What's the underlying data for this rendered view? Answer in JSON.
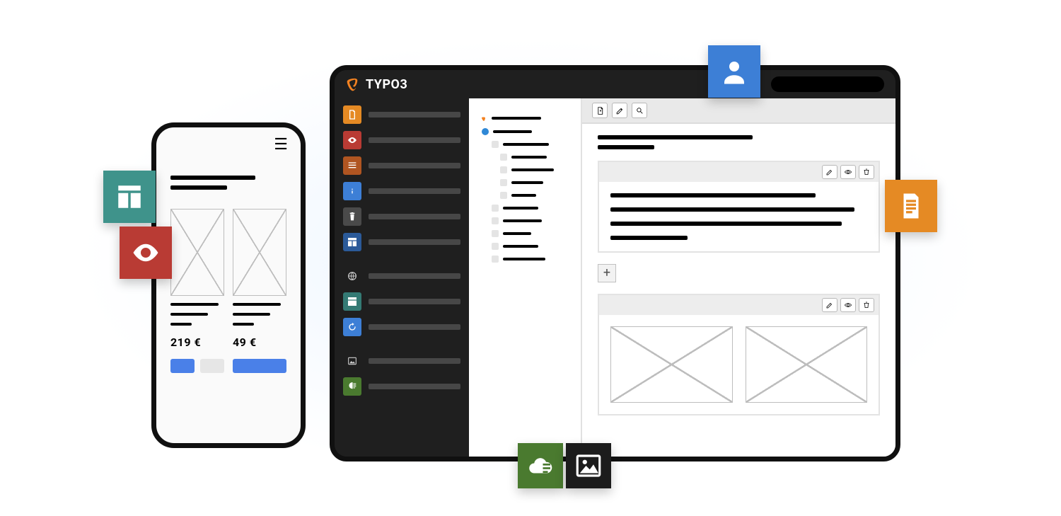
{
  "app": {
    "name": "TYPO3"
  },
  "phone": {
    "products": [
      {
        "price": "219 €"
      },
      {
        "price": "49 €"
      }
    ]
  },
  "sidebar": {
    "items": [
      {
        "icon": "page-icon",
        "color": "#e58a24"
      },
      {
        "icon": "view-icon",
        "color": "#b93b34"
      },
      {
        "icon": "list-icon",
        "color": "#b05521"
      },
      {
        "icon": "info-icon",
        "color": "#3d7fd6"
      },
      {
        "icon": "recycler-icon",
        "color": "#4a4a4a"
      },
      {
        "icon": "template-icon",
        "color": "#2b5a99"
      },
      {
        "icon": "sites-icon",
        "color": "transparent"
      },
      {
        "icon": "filelist-icon",
        "color": "#347a74"
      },
      {
        "icon": "reload-icon",
        "color": "#3d7fd6"
      },
      {
        "icon": "media-icon",
        "color": "transparent"
      },
      {
        "icon": "reports-icon",
        "color": "#4a7a2f"
      }
    ]
  },
  "toolbar": {
    "tools": [
      "new-content-icon",
      "edit-icon",
      "search-icon"
    ]
  },
  "content_header_actions": [
    "edit-icon",
    "toggle-icon",
    "delete-icon"
  ],
  "add_label": "+",
  "floating_tiles": [
    "layout-icon",
    "view-icon",
    "user-icon",
    "document-icon",
    "cloud-icon",
    "image-icon"
  ]
}
